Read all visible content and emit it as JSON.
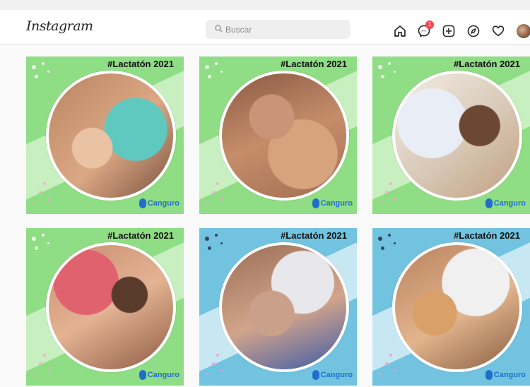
{
  "nav": {
    "logo": "Instagram",
    "search_placeholder": "Buscar",
    "notification_count": "1",
    "icons": [
      "home-icon",
      "messenger-icon",
      "new-post-icon",
      "explore-icon",
      "activity-heart-icon",
      "profile-avatar"
    ]
  },
  "posts": [
    {
      "hashtag": "#Lactatón 2021",
      "brand": "Canguro",
      "theme": "green"
    },
    {
      "hashtag": "#Lactatón 2021",
      "brand": "Canguro",
      "theme": "green"
    },
    {
      "hashtag": "#Lactatón 2021",
      "brand": "Canguro",
      "theme": "green"
    },
    {
      "hashtag": "#Lactatón 2021",
      "brand": "Canguro",
      "theme": "green"
    },
    {
      "hashtag": "#Lactatón 2021",
      "brand": "Canguro",
      "theme": "blue"
    },
    {
      "hashtag": "#Lactatón 2021",
      "brand": "Canguro",
      "theme": "blue"
    }
  ],
  "colors": {
    "green_bg": "#8fdd84",
    "green_light": "#c7efc0",
    "blue_bg": "#71c3e0",
    "blue_light": "#c7e8f3",
    "brand": "#1f6fc9",
    "badge": "#ed4956"
  }
}
